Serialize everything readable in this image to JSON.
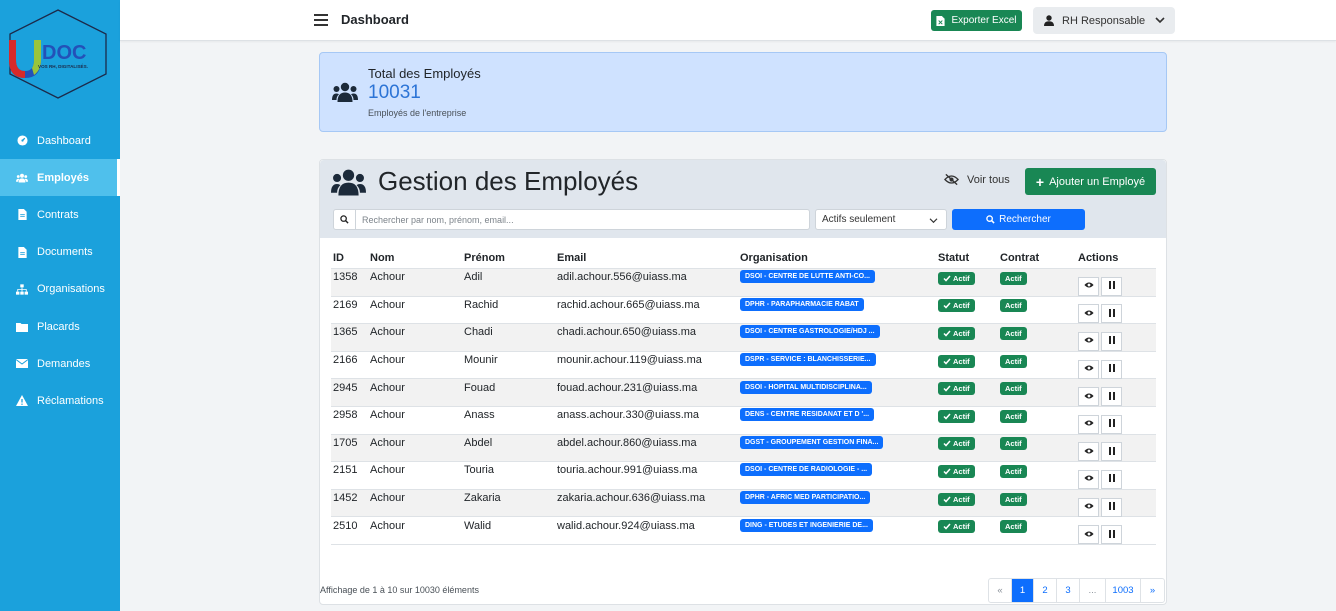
{
  "colors": {
    "sidebar": "#1ba1dc",
    "sidebar_active": "#4fc0ec",
    "success": "#198754",
    "primary": "#0d6efd",
    "info_card": "#cfe2ff"
  },
  "logo": {
    "brand": "DOC",
    "tagline": "VOS RH, DIGITALISÉS."
  },
  "sidebar": {
    "items": [
      {
        "label": "Dashboard",
        "icon": "gauge-icon"
      },
      {
        "label": "Employés",
        "icon": "users-icon",
        "active": true
      },
      {
        "label": "Contrats",
        "icon": "file-icon"
      },
      {
        "label": "Documents",
        "icon": "file-icon"
      },
      {
        "label": "Organisations",
        "icon": "sitemap-icon"
      },
      {
        "label": "Placards",
        "icon": "folder-icon"
      },
      {
        "label": "Demandes",
        "icon": "envelope-icon"
      },
      {
        "label": "Réclamations",
        "icon": "warning-icon"
      }
    ]
  },
  "header": {
    "title": "Dashboard",
    "export_label": "Exporter Excel",
    "user_label": "RH Responsable"
  },
  "total": {
    "label": "Total des Employés",
    "value": "10031",
    "subtitle": "Employés de l'entreprise"
  },
  "main": {
    "title": "Gestion des Employés",
    "voir_tous": "Voir tous",
    "add_label": "Ajouter un Employé",
    "search_placeholder": "Rechercher par nom, prénom, email...",
    "filter_value": "Actifs seulement",
    "search_button": "Rechercher"
  },
  "table": {
    "columns": [
      "ID",
      "Nom",
      "Prénom",
      "Email",
      "Organisation",
      "Statut",
      "Contrat",
      "Actions"
    ],
    "rows": [
      {
        "id": "1358",
        "nom": "Achour",
        "prenom": "Adil",
        "email": "adil.achour.556@uiass.ma",
        "org": "DSOI - CENTRE DE LUTTE ANTI-CO...",
        "statut": "Actif",
        "contrat": "Actif"
      },
      {
        "id": "2169",
        "nom": "Achour",
        "prenom": "Rachid",
        "email": "rachid.achour.665@uiass.ma",
        "org": "DPHR - PARAPHARMACIE RABAT",
        "statut": "Actif",
        "contrat": "Actif"
      },
      {
        "id": "1365",
        "nom": "Achour",
        "prenom": "Chadi",
        "email": "chadi.achour.650@uiass.ma",
        "org": "DSOI - CENTRE GASTROLOGIE/HDJ ...",
        "statut": "Actif",
        "contrat": "Actif"
      },
      {
        "id": "2166",
        "nom": "Achour",
        "prenom": "Mounir",
        "email": "mounir.achour.119@uiass.ma",
        "org": "DSPR - SERVICE : BLANCHISSERIE...",
        "statut": "Actif",
        "contrat": "Actif"
      },
      {
        "id": "2945",
        "nom": "Achour",
        "prenom": "Fouad",
        "email": "fouad.achour.231@uiass.ma",
        "org": "DSOI - HOPITAL MULTIDISCIPLINA...",
        "statut": "Actif",
        "contrat": "Actif"
      },
      {
        "id": "2958",
        "nom": "Achour",
        "prenom": "Anass",
        "email": "anass.achour.330@uiass.ma",
        "org": "DENS - CENTRE RESIDANAT ET D '...",
        "statut": "Actif",
        "contrat": "Actif"
      },
      {
        "id": "1705",
        "nom": "Achour",
        "prenom": "Abdel",
        "email": "abdel.achour.860@uiass.ma",
        "org": "DGST - GROUPEMENT GESTION FINA...",
        "statut": "Actif",
        "contrat": "Actif"
      },
      {
        "id": "2151",
        "nom": "Achour",
        "prenom": "Touria",
        "email": "touria.achour.991@uiass.ma",
        "org": "DSOI - CENTRE DE RADIOLOGIE - ...",
        "statut": "Actif",
        "contrat": "Actif"
      },
      {
        "id": "1452",
        "nom": "Achour",
        "prenom": "Zakaria",
        "email": "zakaria.achour.636@uiass.ma",
        "org": "DPHR - AFRIC MED PARTICIPATIO...",
        "statut": "Actif",
        "contrat": "Actif"
      },
      {
        "id": "2510",
        "nom": "Achour",
        "prenom": "Walid",
        "email": "walid.achour.924@uiass.ma",
        "org": "DING - ETUDES ET INGENIERIE DE...",
        "statut": "Actif",
        "contrat": "Actif"
      }
    ]
  },
  "footer": {
    "info": "Affichage de 1 à 10 sur 10030 éléments",
    "pages": [
      "«",
      "1",
      "2",
      "3",
      "...",
      "1003",
      "»"
    ]
  }
}
